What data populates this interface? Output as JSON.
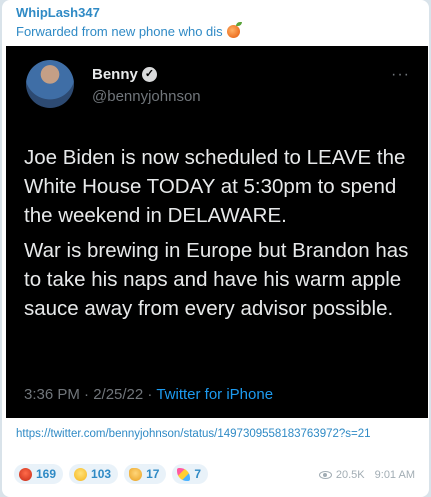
{
  "message": {
    "sender": "WhipLash347",
    "forwarded_from": "Forwarded from new phone who dis",
    "forwarded_emoji": "peach",
    "link": "https://twitter.com/bennyjohnson/status/1497309558183763972?s=21",
    "views": "20.5K",
    "time": "9:01 AM"
  },
  "tweet": {
    "name": "Benny",
    "handle": "@bennyjohnson",
    "more": "···",
    "verified_icon": "✓",
    "paragraph1": "Joe Biden is now scheduled to LEAVE the White House TODAY at 5:30pm to spend the weekend in DELAWARE.",
    "paragraph2": "War is brewing in Europe but Brandon has to take his naps and have his warm apple sauce away from every advisor possible.",
    "timestamp": "3:36 PM · 2/25/22 · ",
    "source": "Twitter for iPhone"
  },
  "reactions": [
    {
      "emoji": "angry-face",
      "count": "169"
    },
    {
      "emoji": "grinning-face",
      "count": "103"
    },
    {
      "emoji": "thumbs-up",
      "count": "17"
    },
    {
      "emoji": "party-popper",
      "count": "7"
    }
  ],
  "colors": {
    "accent": "#2f8ac5",
    "tweet_bg": "#000000",
    "tweet_link": "#1d9bf0"
  }
}
